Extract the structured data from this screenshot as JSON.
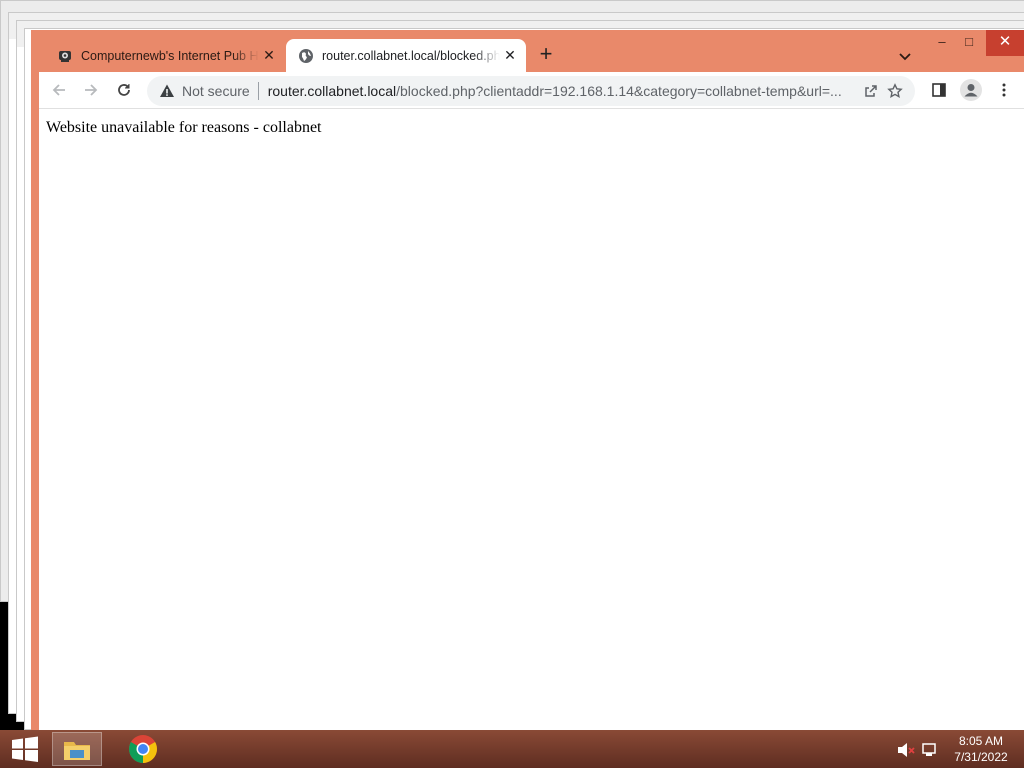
{
  "browser": {
    "tabs": [
      {
        "title": "Computernewb's Internet Pub Hub",
        "favicon": "computernewb-icon",
        "active": false
      },
      {
        "title": "router.collabnet.local/blocked.php",
        "favicon": "globe-icon",
        "active": true
      }
    ],
    "new_tab_label": "+",
    "window_controls": {
      "minimize": "–",
      "maximize": "□",
      "close": "✕"
    }
  },
  "toolbar": {
    "security_label": "Not secure",
    "url_host": "router.collabnet.local",
    "url_rest": "/blocked.php?clientaddr=192.168.1.14&category=collabnet-temp&url=..."
  },
  "page": {
    "message": "Website unavailable for reasons - collabnet"
  },
  "taskbar": {
    "time": "8:05 AM",
    "date": "7/31/2022"
  },
  "colors": {
    "frame": "#e9896a",
    "close": "#c7402f",
    "taskbar": "#6e3828"
  }
}
